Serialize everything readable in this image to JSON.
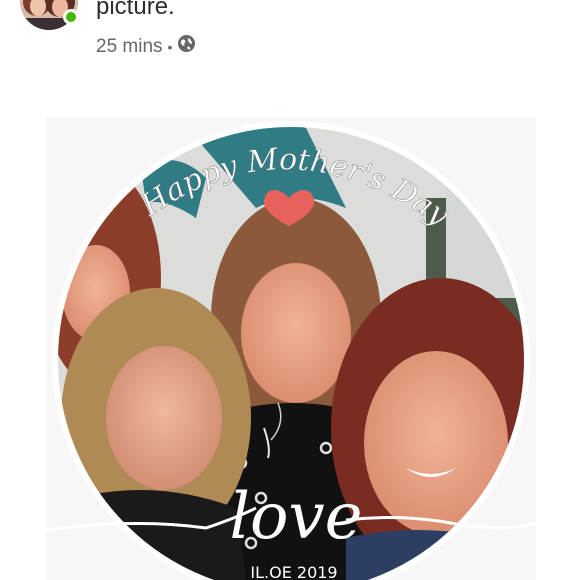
{
  "post": {
    "caption_fragment": "picture.",
    "time": "25 mins",
    "separator": "•",
    "privacy_icon": "globe-icon"
  },
  "photo": {
    "top_text": "Happy Mother's Day",
    "bottom_word": "love",
    "date_partial": "IL.OE 2019",
    "heart_color": "#e8615d"
  },
  "colors": {
    "online": "#44b700",
    "meta": "#65676b",
    "caption": "#2b2d31"
  }
}
